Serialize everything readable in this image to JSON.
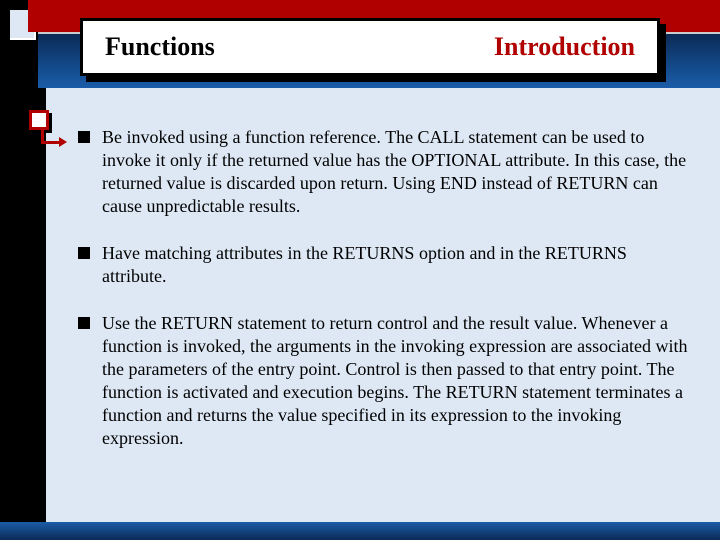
{
  "header": {
    "title_left": "Functions",
    "title_right": "Introduction"
  },
  "bullets": [
    {
      "text": "Be invoked using a function reference. The CALL statement can be used to invoke it only if the returned value has the OPTIONAL attribute. In this case, the returned value is discarded upon return. Using END instead of RETURN can cause unpredictable results."
    },
    {
      "text": "Have matching attributes in the RETURNS option and in the RETURNS attribute."
    },
    {
      "text": "Use the RETURN statement to return control and the result value. Whenever a function is invoked, the arguments in the invoking expression are associated with the parameters of the entry point. Control is then passed to that entry point. The function is activated and execution begins. The RETURN statement terminates a function and returns the value specified in its expression to the invoking expression."
    }
  ]
}
